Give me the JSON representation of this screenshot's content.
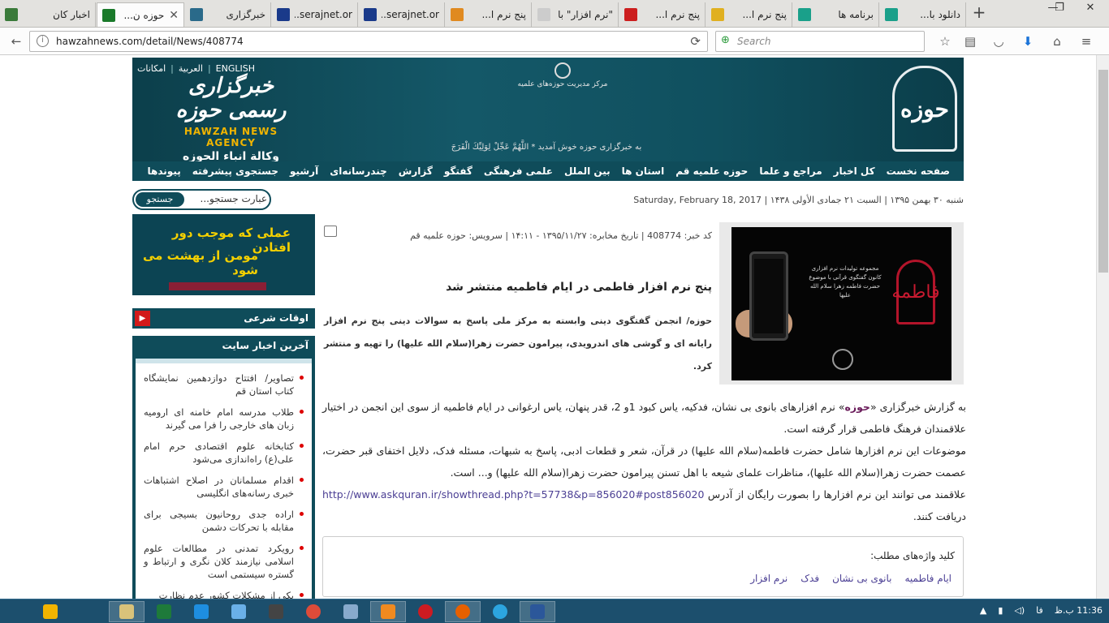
{
  "browser": {
    "tabs": [
      {
        "title": "اخبار کان",
        "color": "#3a7a3a"
      },
      {
        "title": "حوزه ن...",
        "color": "#1a7a2a"
      },
      {
        "title": "خبرگزاری",
        "color": "#2a6a8a"
      },
      {
        "title": "serajnet.or...",
        "color": "#1a3a8a"
      },
      {
        "title": "serajnet.or...",
        "color": "#1a3a8a"
      },
      {
        "title": "پنج نرم ا...",
        "color": "#e08a20"
      },
      {
        "title": "\"نرم افزار\" با",
        "color": "#cccccc"
      },
      {
        "title": "پنج نرم ا...",
        "color": "#cc1e1e"
      },
      {
        "title": "پنج نرم ا...",
        "color": "#e0b020"
      },
      {
        "title": "برنامه ها",
        "color": "#1aa08a"
      },
      {
        "title": "دانلود با...",
        "color": "#1aa08a"
      }
    ],
    "new_tab": "+",
    "minimize": "—",
    "restore": "❐",
    "close": "✕",
    "url": "hawzahnews.com/detail/News/408774",
    "search_placeholder": "Search"
  },
  "header": {
    "logo": "حوزه",
    "brand_fa": "خبرگزاری رسمی حوزه",
    "brand_en": "HAWZAH NEWS AGENCY",
    "brand_ar": "وكالة انباء الحوزه",
    "langs": [
      "امکانات",
      "العربية",
      "ENGLISH"
    ],
    "center": "مرکز مدیریت حوزه‌های علمیه",
    "motto": "به خبرگزاری حوزه خوش آمدید * اللَّهُمَّ عَجِّلْ لِوَلِيِّكَ الْفَرَجَ"
  },
  "menu": [
    "صفحه نخست",
    "کل اخبار",
    "مراجع و علما",
    "حوزه علمیه قم",
    "استان ها",
    "بین الملل",
    "علمی فرهنگی",
    "گفتگو",
    "گزارش",
    "چندرسانه‌ای",
    "آرشیو",
    "جستجوی پیشرفته",
    "پیوندها"
  ],
  "datebar": {
    "date": "شنبه ۳۰ بهمن ۱۳۹۵ | السبت ۲۱ جمادی الأولى ۱۴۳۸ | Saturday, February 18, 2017",
    "search_button": "جستجو",
    "search_placeholder": "عبارت جستجو..."
  },
  "sidebar": {
    "banner_line1": "عملی که موجب دور افتادن",
    "banner_line2": "مومن از بهشت می شود",
    "owqat": "اوقات شرعی",
    "latest_title": "آخرین اخبار سایت",
    "news": [
      "تصاویر/ افتتاح دوازدهمین نمایشگاه کتاب استان قم",
      "طلاب مدرسه امام خامنه ای ارومیه زبان های خارجی را فرا می گیرند",
      "کتابخانه علوم اقتصادی حرم امام علی(ع) راه‌اندازی می‌شود",
      "اقدام مسلمانان در اصلاح اشتباهات خبری رسانه‌های انگلیسی",
      "اراده جدی روحانیون بسیجی برای مقابله با تحرکات دشمن",
      "رویکرد تمدنی در مطالعات علوم اسلامی نیازمند کلان نگری و ارتباط و گستره سیستمی است",
      "یکی از مشکلات کشور عدم نظارت"
    ]
  },
  "article": {
    "meta": "کد خبر: 408774 | تاریخ مخابره: ۱۳۹۵/۱۱/۲۷ - ۱۴:۱۱ | سرویس: حوزه علمیه قم",
    "headline": "پنج نرم افزار فاطمی در ایام فاطمیه منتشر شد",
    "lead": "حوزه/ انجمن گفتگوی دینی وابسته به مرکز ملی پاسخ به سوالات دینی پنج نرم افزار رایانه ای و گوشی های اندرویدی، پیرامون حضرت زهرا(سلام الله علیها) را تهیه و منتشر کرد.",
    "image_caption": "مجموعه تولیدات نرم افزاری کانون گفتگوی قرآنی با موضوع حضرت فاطمه زهرا سلام الله علیها",
    "image_calligraphy": "فاطمه",
    "p1_pre": "به گزارش خبرگزاری «",
    "p1_hz": "حوزه",
    "p1_post": "» نرم افزارهای بانوی بی نشان، فدکیه، یاس کبود 1و 2، قدر پنهان، یاس ارغوانی در ایام فاطمیه از سوی این انجمن در اختیار علاقمندان فرهنگ فاطمی قرار گرفته است.",
    "p2": "موضوعات این نرم افزارها شامل حضرت فاطمه(سلام الله علیها) در قرآن، شعر و قطعات ادبی، پاسخ به شبهات، مسئله فدک، دلایل اختفای قبر حضرت، عصمت حضرت زهرا(سلام الله علیها)، مناظرات علمای شیعه با اهل تسنن پیرامون حضرت زهرا(سلام الله علیها) و... است.",
    "p3_pre": "علاقمند می توانند این نرم افزارها را بصورت رایگان از آدرس",
    "p3_link": "http://www.askquran.ir/showthread.php?t=57738&p=856020#post856020",
    "p3_post": "دریافت کنند.",
    "keywords_title": "کلید واژه‌های مطلب:",
    "keywords": [
      "نرم افزار",
      "فدک",
      "بانوی بی نشان",
      "ایام فاطمیه"
    ]
  },
  "taskbar": {
    "apps": [
      {
        "name": "start",
        "color": "#f2b400"
      },
      {
        "name": "windows-explorer",
        "color": "#d9c27a"
      },
      {
        "name": "excel",
        "color": "#1e7a3a"
      },
      {
        "name": "dropbox",
        "color": "#1e8ee0"
      },
      {
        "name": "onedrive",
        "color": "#6ab0e8"
      },
      {
        "name": "app",
        "color": "#444444"
      },
      {
        "name": "chrome",
        "color": "#dd4b39"
      },
      {
        "name": "app2",
        "color": "#88aacc"
      },
      {
        "name": "media-player",
        "color": "#f08a20"
      },
      {
        "name": "opera",
        "color": "#cc1b22"
      },
      {
        "name": "firefox",
        "color": "#e66000"
      },
      {
        "name": "telegram",
        "color": "#2ca5e0"
      },
      {
        "name": "word",
        "color": "#2b579a"
      }
    ],
    "lang": "فا",
    "time": "11:36 ب.ظ"
  }
}
